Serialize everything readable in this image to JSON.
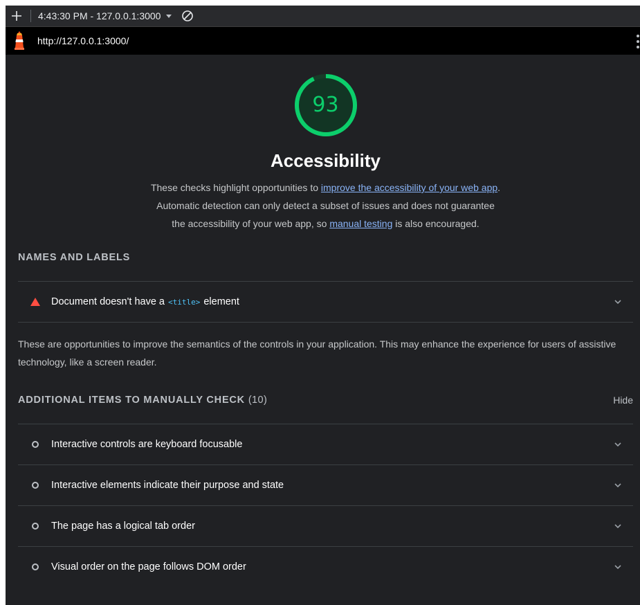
{
  "toolbar": {
    "new_report_icon": "plus-icon",
    "report_label": "4:43:30 PM - 127.0.0.1:3000",
    "clear_icon": "block-icon"
  },
  "urlbar": {
    "logo_icon": "lighthouse-icon",
    "url": "http://127.0.0.1:3000/"
  },
  "score": {
    "value": "93",
    "color": "#0cce6b",
    "fraction": 0.93
  },
  "category": {
    "title": "Accessibility",
    "desc_part1": "These checks highlight opportunities to ",
    "desc_link1": "improve the accessibility of your web app",
    "desc_part2": ". Automatic detection can only detect a subset of issues and does not guarantee the accessibility of your web app, so ",
    "desc_link2": "manual testing",
    "desc_part3": " is also encouraged."
  },
  "names_labels": {
    "header": "NAMES AND LABELS",
    "audit": {
      "text_before": "Document doesn't have a",
      "code": "<title>",
      "text_after": "element",
      "status_color": "#ff4e42"
    },
    "description": "These are opportunities to improve the semantics of the controls in your application. This may enhance the experience for users of assistive technology, like a screen reader."
  },
  "manual": {
    "header": "ADDITIONAL ITEMS TO MANUALLY CHECK",
    "count": "(10)",
    "hide_label": "Hide",
    "items": [
      "Interactive controls are keyboard focusable",
      "Interactive elements indicate their purpose and state",
      "The page has a logical tab order",
      "Visual order on the page follows DOM order"
    ]
  }
}
